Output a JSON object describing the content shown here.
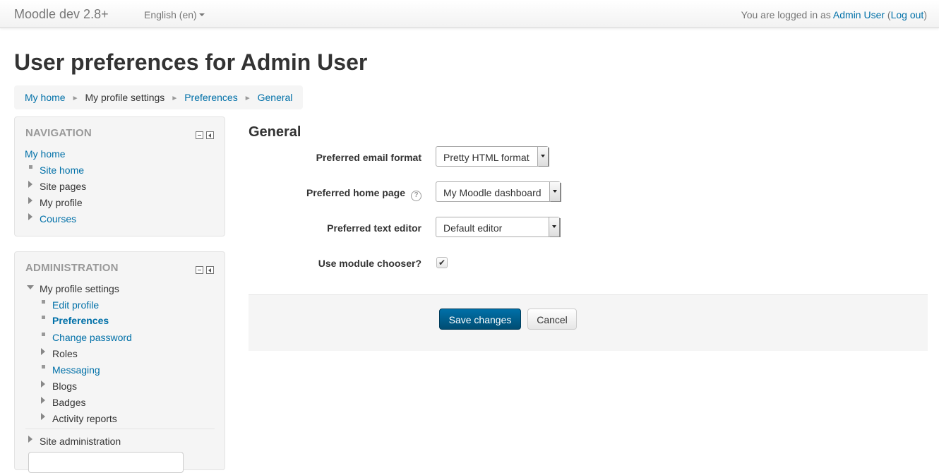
{
  "navbar": {
    "brand": "Moodle dev 2.8+",
    "language": "English (en)",
    "login_prefix": "You are logged in as ",
    "user_name": "Admin User",
    "logout_open": " (",
    "logout_label": "Log out",
    "logout_close": ")"
  },
  "page": {
    "title": "User preferences for Admin User"
  },
  "breadcrumb": {
    "items": [
      "My home",
      "My profile settings",
      "Preferences",
      "General"
    ],
    "separator": "►"
  },
  "navigation_block": {
    "title": "NAVIGATION",
    "root": "My home",
    "items": [
      {
        "label": "Site home",
        "marker": "bullet",
        "link": true
      },
      {
        "label": "Site pages",
        "marker": "collapsed",
        "link": false
      },
      {
        "label": "My profile",
        "marker": "collapsed",
        "link": false
      },
      {
        "label": "Courses",
        "marker": "collapsed",
        "link": true
      }
    ]
  },
  "administration_block": {
    "title": "ADMINISTRATION",
    "root": "My profile settings",
    "items": [
      {
        "label": "Edit profile",
        "marker": "bullet",
        "link": true
      },
      {
        "label": "Preferences",
        "marker": "bullet",
        "link": true,
        "active": true
      },
      {
        "label": "Change password",
        "marker": "bullet",
        "link": true
      },
      {
        "label": "Roles",
        "marker": "collapsed",
        "link": false
      },
      {
        "label": "Messaging",
        "marker": "bullet",
        "link": true
      },
      {
        "label": "Blogs",
        "marker": "collapsed",
        "link": false
      },
      {
        "label": "Badges",
        "marker": "collapsed",
        "link": false
      },
      {
        "label": "Activity reports",
        "marker": "collapsed",
        "link": false
      }
    ],
    "site_admin": "Site administration"
  },
  "form": {
    "section_title": "General",
    "fields": [
      {
        "label": "Preferred email format",
        "value": "Pretty HTML format"
      },
      {
        "label": "Preferred home page",
        "value": "My Moodle dashboard",
        "help": "?"
      },
      {
        "label": "Preferred text editor",
        "value": "Default editor"
      },
      {
        "label": "Use module chooser?",
        "checked": true
      }
    ],
    "checkmark": "✔",
    "save_label": "Save changes",
    "cancel_label": "Cancel"
  },
  "colors": {
    "link": "#0070a8",
    "primary_button": "#0070a8",
    "block_background": "#f5f5f5"
  }
}
